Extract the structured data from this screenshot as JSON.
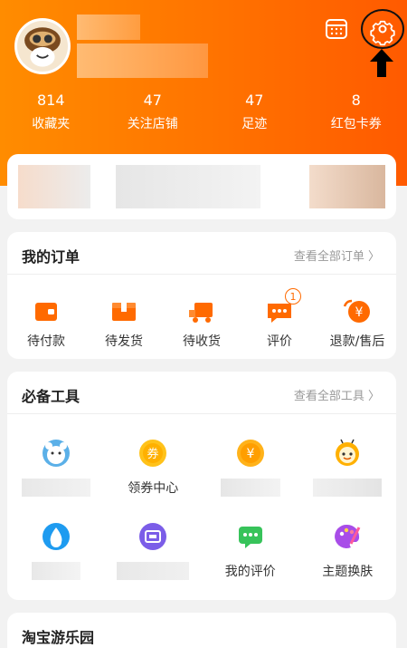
{
  "stats": [
    {
      "value": "814",
      "label": "收藏夹"
    },
    {
      "value": "47",
      "label": "关注店铺"
    },
    {
      "value": "47",
      "label": "足迹"
    },
    {
      "value": "8",
      "label": "红包卡券"
    }
  ],
  "orders": {
    "title": "我的订单",
    "more": "查看全部订单 〉",
    "items": [
      {
        "label": "待付款",
        "icon": "wallet-icon"
      },
      {
        "label": "待发货",
        "icon": "box-icon"
      },
      {
        "label": "待收货",
        "icon": "truck-icon"
      },
      {
        "label": "评价",
        "icon": "comment-icon",
        "badge": "1"
      },
      {
        "label": "退款/售后",
        "icon": "refund-icon"
      }
    ]
  },
  "tools": {
    "title": "必备工具",
    "more": "查看全部工具 〉",
    "row1": [
      {
        "label": "",
        "icon": "bear-icon"
      },
      {
        "label": "领券中心",
        "icon": "coupon-icon"
      },
      {
        "label": "",
        "icon": "yen-coin-icon"
      },
      {
        "label": "",
        "icon": "bee-icon"
      }
    ],
    "row2": [
      {
        "label": "",
        "icon": "water-drop-icon"
      },
      {
        "label": "",
        "icon": "wallet-purple-icon"
      },
      {
        "label": "我的评价",
        "icon": "chat-icon"
      },
      {
        "label": "主题换肤",
        "icon": "palette-icon"
      }
    ]
  },
  "park": {
    "title": "淘宝游乐园"
  },
  "colors": {
    "accent": "#ff6a00",
    "header_start": "#ff8c00",
    "header_end": "#ff5a00"
  }
}
